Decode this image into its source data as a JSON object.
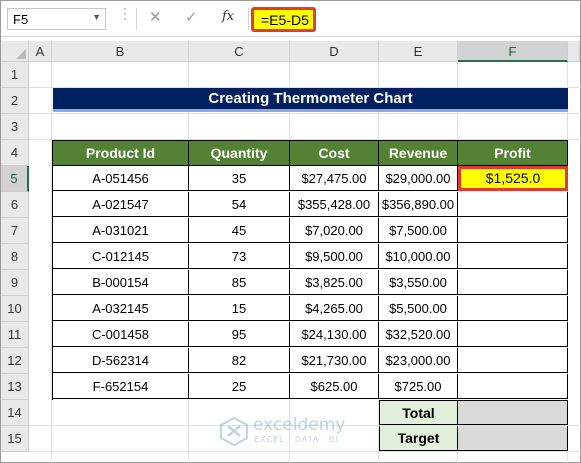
{
  "formula_bar": {
    "name_box": "F5",
    "fx_label": "fx",
    "formula": "=E5-D5"
  },
  "columns": [
    "A",
    "B",
    "C",
    "D",
    "E",
    "F"
  ],
  "rows": [
    "1",
    "2",
    "3",
    "4",
    "5",
    "6",
    "7",
    "8",
    "9",
    "10",
    "11",
    "12",
    "13",
    "14",
    "15"
  ],
  "title": "Creating Thermometer Chart",
  "table": {
    "headers": [
      "Product Id",
      "Quantity",
      "Cost",
      "Revenue",
      "Profit"
    ],
    "rows": [
      [
        "A-051456",
        "35",
        "$27,475.00",
        "$29,000.00",
        "$1,525.0"
      ],
      [
        "A-021547",
        "54",
        "$355,428.00",
        "$356,890.00",
        ""
      ],
      [
        "A-031021",
        "45",
        "$7,020.00",
        "$7,500.00",
        ""
      ],
      [
        "C-012145",
        "73",
        "$9,500.00",
        "$10,000.00",
        ""
      ],
      [
        "B-000154",
        "85",
        "$3,825.00",
        "$3,550.00",
        ""
      ],
      [
        "A-032145",
        "15",
        "$4,265.00",
        "$5,500.00",
        ""
      ],
      [
        "C-001458",
        "95",
        "$24,130.00",
        "$32,520.00",
        ""
      ],
      [
        "D-562314",
        "82",
        "$21,730.00",
        "$23,000.00",
        ""
      ],
      [
        "F-652154",
        "25",
        "$625.00",
        "$725.00",
        ""
      ]
    ],
    "summary": [
      {
        "label": "Total",
        "value": ""
      },
      {
        "label": "Target",
        "value": ""
      }
    ]
  },
  "watermark": {
    "name": "exceldemy",
    "tagline": "EXCEL · DATA · BI"
  },
  "colors": {
    "title_bg": "#002060",
    "header_bg": "#548235",
    "highlight": "#ffff00",
    "highlight_border": "#e23b2e",
    "summary_label_bg": "#e2efda",
    "summary_value_bg": "#d9d9d9"
  }
}
